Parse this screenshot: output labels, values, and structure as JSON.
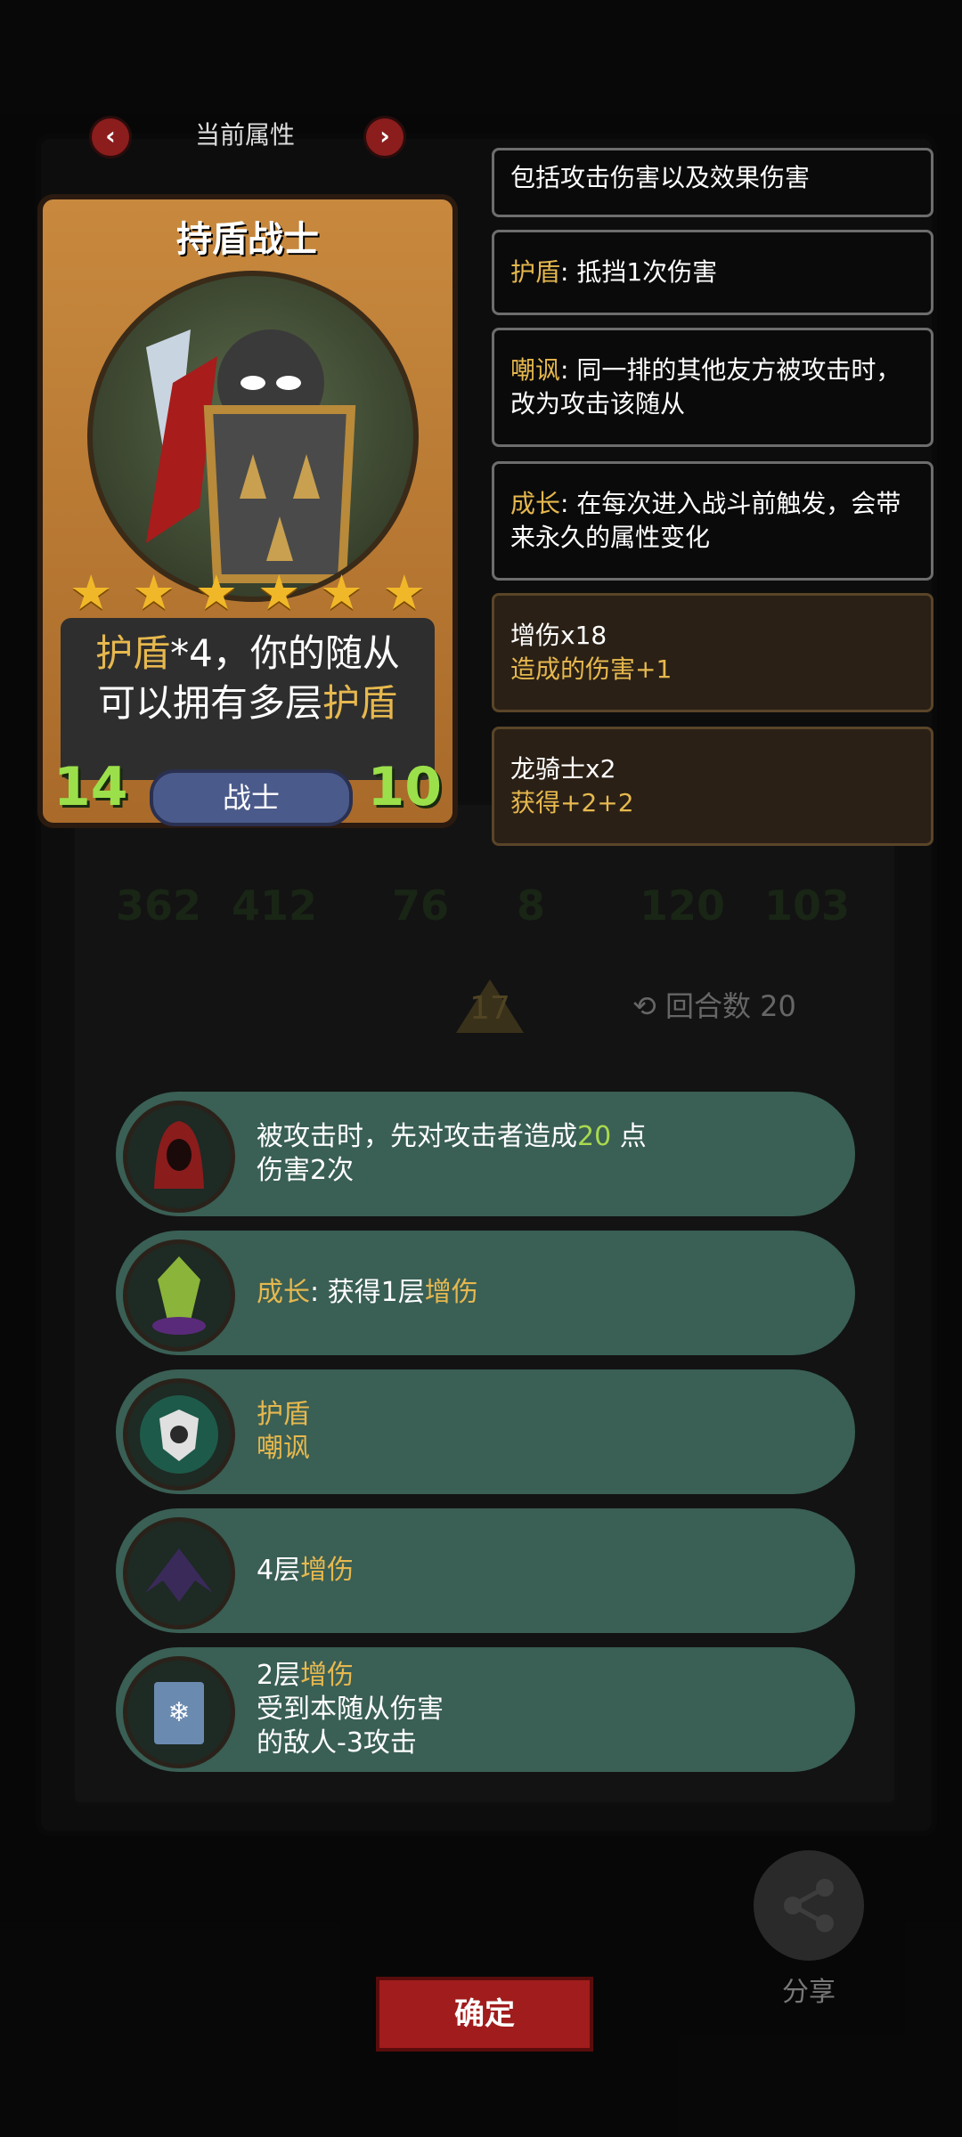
{
  "header": {
    "title": "当前属性"
  },
  "card": {
    "name": "持盾战士",
    "star_count": 6,
    "desc_line1_a": "护盾",
    "desc_line1_b": "*4，你的随从",
    "desc_line2_a": "可以拥有多层",
    "desc_line2_b": "护盾",
    "attack": "14",
    "health": "10",
    "type": "战士"
  },
  "panels": [
    {
      "text": "包括攻击伤害以及效果伤害"
    },
    {
      "kw": "护盾",
      "text": ": 抵挡1次伤害"
    },
    {
      "kw": "嘲讽",
      "text": ": 同一排的其他友方被攻击时，改为攻击该随从"
    },
    {
      "kw": "成长",
      "text": ": 在每次进入战斗前触发，会带来永久的属性变化"
    },
    {
      "line1": "增伤x18",
      "line2": "造成的伤害+1"
    },
    {
      "line1": "龙骑士x2",
      "line2": "获得+2+2"
    }
  ],
  "background": {
    "stats": [
      "362",
      "412",
      "76",
      "8",
      "120",
      "103"
    ],
    "level": "17",
    "round_label": "回合数",
    "round_value": "20"
  },
  "skills": [
    {
      "a": "被攻击时，先对攻击者造成",
      "b": "20",
      "c": "点",
      "d": "伤害2次",
      "icon": "red-hood-icon"
    },
    {
      "a": "成长",
      "b": ": 获得1层",
      "c": "增伤",
      "icon": "green-crystal-icon"
    },
    {
      "a": "护盾",
      "b": "嘲讽",
      "icon": "shield-taunt-icon"
    },
    {
      "a": "4层",
      "b": "增伤",
      "icon": "dark-wings-icon"
    },
    {
      "a": "2层",
      "b": "增伤",
      "c": "受到本随从伤害",
      "d": "的敌人-3攻击",
      "icon": "frost-book-icon"
    }
  ],
  "buttons": {
    "confirm": "确定",
    "share": "分享"
  }
}
